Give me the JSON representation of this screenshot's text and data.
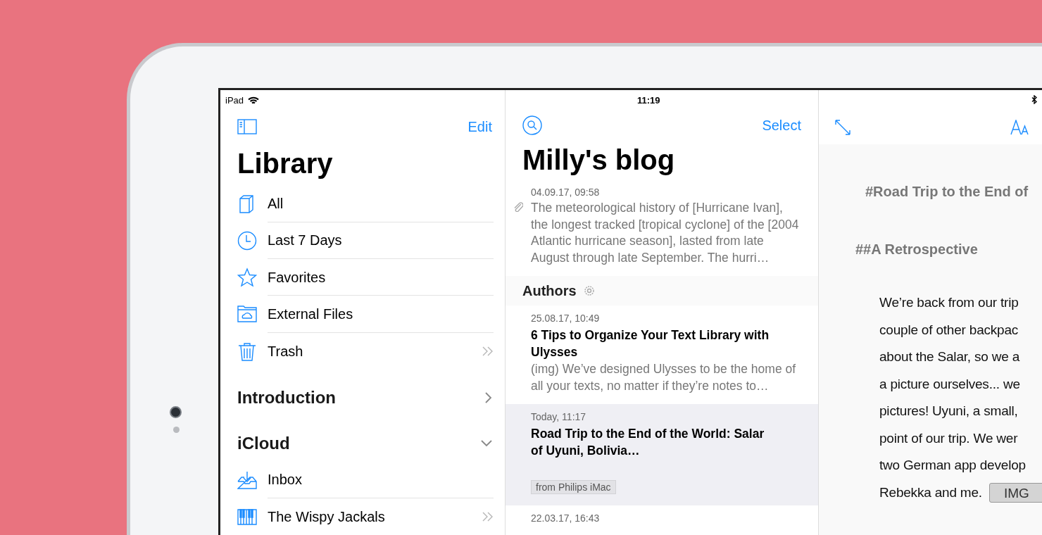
{
  "status_bar": {
    "device": "iPad",
    "time": "11:19"
  },
  "sidebar": {
    "edit_label": "Edit",
    "title": "Library",
    "items": [
      {
        "kind": "all",
        "label": "All",
        "has_subgroups": false
      },
      {
        "kind": "recent",
        "label": "Last 7 Days",
        "has_subgroups": false
      },
      {
        "kind": "favorites",
        "label": "Favorites",
        "has_subgroups": false
      },
      {
        "kind": "external",
        "label": "External Files",
        "has_subgroups": false
      },
      {
        "kind": "trash",
        "label": "Trash",
        "has_subgroups": true
      }
    ],
    "sections": [
      {
        "title": "Introduction",
        "expanded": false
      },
      {
        "title": "iCloud",
        "expanded": true,
        "items": [
          {
            "kind": "inbox",
            "label": "Inbox",
            "has_subgroups": false
          },
          {
            "kind": "group",
            "label": "The Wispy Jackals",
            "has_subgroups": true
          }
        ]
      }
    ]
  },
  "sheet_list": {
    "select_label": "Select",
    "title": "Milly's blog",
    "sheets": [
      {
        "date": "04.09.17, 09:58",
        "excerpt": "The meteorological history of [Hurricane Ivan], the longest tracked [tropical cyclone] of the [2004 Atlantic hurricane season], lasted from late August through late September. The hurri…",
        "attachment": true,
        "selected": false
      }
    ],
    "groups": [
      {
        "title": "Authors",
        "sheets": [
          {
            "date": "25.08.17, 10:49",
            "title": "6 Tips to Organize Your Text Library with Ulysses",
            "excerpt": "(img) We’ve designed Ulysses to be the home of all your texts, no matter if they’re notes to…",
            "attachment": false,
            "selected": false
          },
          {
            "date": "Today, 11:17",
            "title": "Road Trip to the End of the World: Salar of Uyuni, Bolivia…",
            "tag": "from Philips iMac",
            "attachment": false,
            "selected": true
          },
          {
            "date": "22.03.17, 16:43",
            "attachment": false,
            "selected": false
          }
        ]
      }
    ]
  },
  "editor": {
    "heading_1": "#Road Trip to the End of",
    "heading_2": "##A Retrospective",
    "lines": [
      "We’re back from our trip",
      "couple of other backpac",
      "about the Salar, so we a",
      "a picture ourselves... we",
      "pictures! Uyuni, a small,",
      "point of our trip. We wer",
      "two German app develop",
      "Rebekka and me."
    ],
    "image_button": "IMG"
  }
}
